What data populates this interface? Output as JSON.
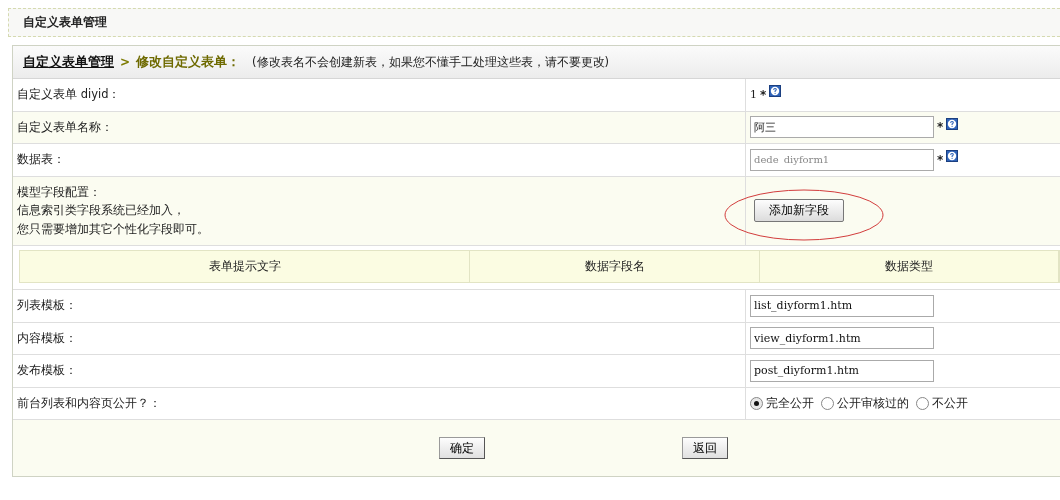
{
  "page_title": "自定义表单管理",
  "breadcrumb": {
    "link": "自定义表单管理",
    "separator": ">",
    "current": "修改自定义表单：",
    "note": "(修改表名不会创建新表，如果您不懂手工处理这些表，请不要更改)"
  },
  "rows": [
    {
      "kind": "static",
      "label": "自定义表单 diyid：",
      "value": "1",
      "marker": "*",
      "help": true,
      "shaded": false
    },
    {
      "kind": "input",
      "label": "自定义表单名称：",
      "value": "阿三",
      "disabled": false,
      "marker": "*",
      "help": true,
      "shaded": true
    },
    {
      "kind": "input",
      "label": "数据表：",
      "value": "dede_diyform1",
      "disabled": true,
      "marker": "*",
      "help": true,
      "shaded": false
    },
    {
      "kind": "button",
      "label_lines": [
        "模型字段配置：",
        "信息索引类字段系统已经加入，",
        "您只需要增加其它个性化字段即可。"
      ],
      "button": "添加新字段",
      "highlighted": true,
      "shaded": true
    },
    {
      "kind": "fields_header",
      "columns": [
        "表单提示文字",
        "数据字段名",
        "数据类型"
      ]
    },
    {
      "kind": "input",
      "label": "列表模板：",
      "value": "list_diyform1.htm",
      "disabled": false,
      "help": false,
      "shaded": false
    },
    {
      "kind": "input",
      "label": "内容模板：",
      "value": "view_diyform1.htm",
      "disabled": false,
      "help": false,
      "shaded": false
    },
    {
      "kind": "input",
      "label": "发布模板：",
      "value": "post_diyform1.htm",
      "disabled": false,
      "help": false,
      "shaded": false
    },
    {
      "kind": "radio",
      "label": "前台列表和内容页公开？：",
      "options": [
        {
          "label": "完全公开",
          "selected": true
        },
        {
          "label": "公开审核过的",
          "selected": false
        },
        {
          "label": "不公开",
          "selected": false
        }
      ],
      "shaded": false
    }
  ],
  "buttons": [
    "确定",
    "返回"
  ]
}
